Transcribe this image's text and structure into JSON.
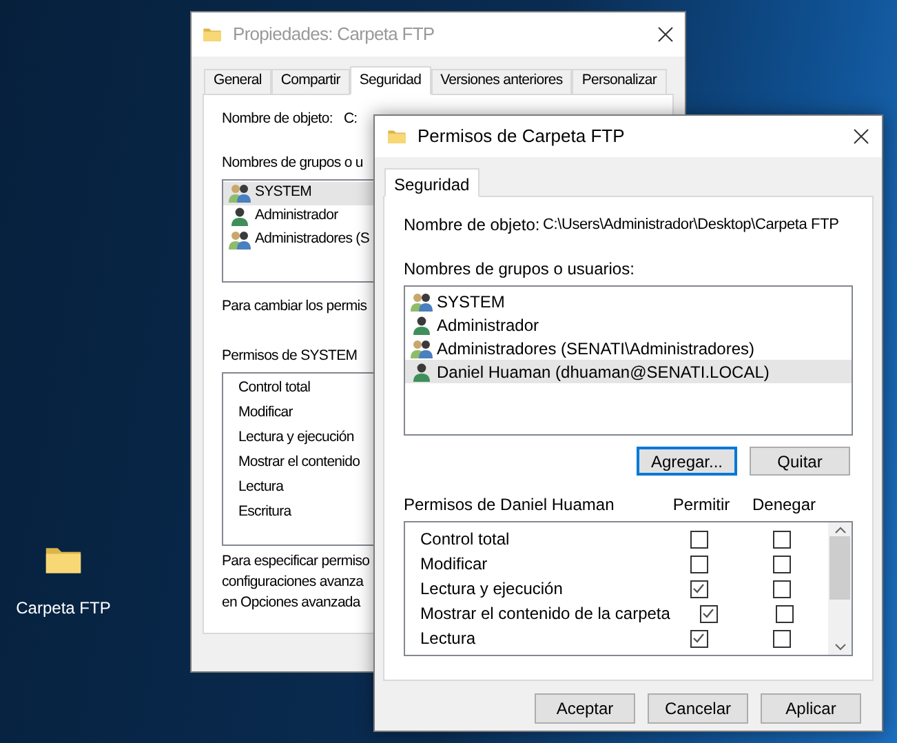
{
  "desktop_icons": [
    {
      "label": "Carpeta FTP"
    }
  ],
  "back_window": {
    "title": "Propiedades: Carpeta FTP",
    "tabs": [
      {
        "label": "General",
        "selected": false
      },
      {
        "label": "Compartir",
        "selected": false
      },
      {
        "label": "Seguridad",
        "selected": true
      },
      {
        "label": "Versiones anteriores",
        "selected": false
      },
      {
        "label": "Personalizar",
        "selected": false
      }
    ],
    "object_label": "Nombre de objeto:",
    "object_value": "C:",
    "groups_label": "Nombres de grupos o u",
    "groups": [
      {
        "name": "SYSTEM",
        "kind": "group",
        "selected": true
      },
      {
        "name": "Administrador",
        "kind": "user",
        "selected": false
      },
      {
        "name": "Administradores (S",
        "kind": "group",
        "selected": false
      }
    ],
    "change_hint": "Para cambiar los permis",
    "permissions_label": "Permisos de SYSTEM",
    "permissions": [
      "Control total",
      "Modificar",
      "Lectura y ejecución",
      "Mostrar el contenido",
      "Lectura",
      "Escritura"
    ],
    "advanced_hint": [
      "Para especificar permiso",
      "configuraciones avanza",
      "en Opciones avanzada"
    ]
  },
  "front_window": {
    "title": "Permisos de Carpeta FTP",
    "tabs": [
      {
        "label": "Seguridad",
        "selected": true
      }
    ],
    "object_label": "Nombre de objeto:",
    "object_value": "C:\\Users\\Administrador\\Desktop\\Carpeta FTP",
    "groups_label": "Nombres de grupos o usuarios:",
    "groups": [
      {
        "name": "SYSTEM",
        "kind": "group",
        "selected": false
      },
      {
        "name": "Administrador",
        "kind": "user",
        "selected": false
      },
      {
        "name": "Administradores (SENATI\\Administradores)",
        "kind": "group",
        "selected": false
      },
      {
        "name": "Daniel Huaman (dhuaman@SENATI.LOCAL)",
        "kind": "user",
        "selected": true
      }
    ],
    "group_buttons": [
      {
        "label": "Agregar...",
        "focused": true
      },
      {
        "label": "Quitar",
        "focused": false
      }
    ],
    "permissions_label": "Permisos de Daniel Huaman",
    "permission_columns": [
      "Permitir",
      "Denegar"
    ],
    "permissions": [
      {
        "name": "Control total",
        "allow": false,
        "deny": false
      },
      {
        "name": "Modificar",
        "allow": false,
        "deny": false
      },
      {
        "name": "Lectura y ejecución",
        "allow": true,
        "deny": false
      },
      {
        "name": "Mostrar el contenido de la carpeta",
        "allow": true,
        "deny": false
      },
      {
        "name": "Lectura",
        "allow": true,
        "deny": false
      }
    ],
    "buttons": [
      "Aceptar",
      "Cancelar",
      "Aplicar"
    ]
  }
}
